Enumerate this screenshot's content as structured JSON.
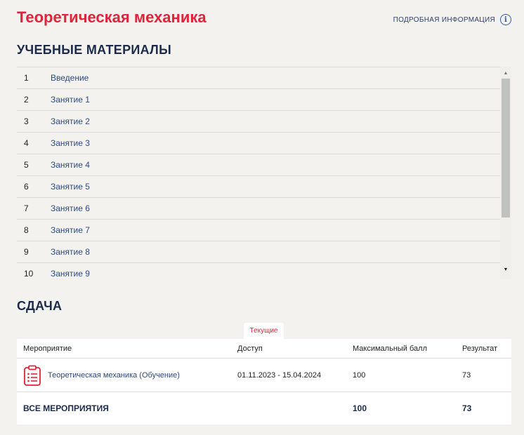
{
  "header": {
    "title": "Теоретическая механика",
    "info_label": "ПОДРОБНАЯ ИНФОРМАЦИЯ",
    "info_icon": "info-icon"
  },
  "materials": {
    "title": "УЧЕБНЫЕ МАТЕРИАЛЫ",
    "items": [
      {
        "num": "1",
        "label": "Введение"
      },
      {
        "num": "2",
        "label": "Занятие 1"
      },
      {
        "num": "3",
        "label": "Занятие 2"
      },
      {
        "num": "4",
        "label": "Занятие 3"
      },
      {
        "num": "5",
        "label": "Занятие 4"
      },
      {
        "num": "6",
        "label": "Занятие 5"
      },
      {
        "num": "7",
        "label": "Занятие 6"
      },
      {
        "num": "8",
        "label": "Занятие 7"
      },
      {
        "num": "9",
        "label": "Занятие 8"
      },
      {
        "num": "10",
        "label": "Занятие 9"
      }
    ]
  },
  "submission": {
    "title": "СДАЧА",
    "tab_current": "Текущие",
    "columns": {
      "event": "Мероприятие",
      "access": "Доступ",
      "max_score": "Максимальный балл",
      "result": "Результат"
    },
    "rows": [
      {
        "icon": "clipboard-icon",
        "event": "Теоретическая механика (Обучение)",
        "access": "01.11.2023 - 15.04.2024",
        "max_score": "100",
        "result": "73"
      }
    ],
    "total": {
      "label": "ВСЕ МЕРОПРИЯТИЯ",
      "max_score": "100",
      "result": "73"
    }
  },
  "colors": {
    "accent": "#e0243a",
    "link": "#2c4a7d",
    "heading": "#1c2b4a",
    "background": "#f3f2ef"
  }
}
